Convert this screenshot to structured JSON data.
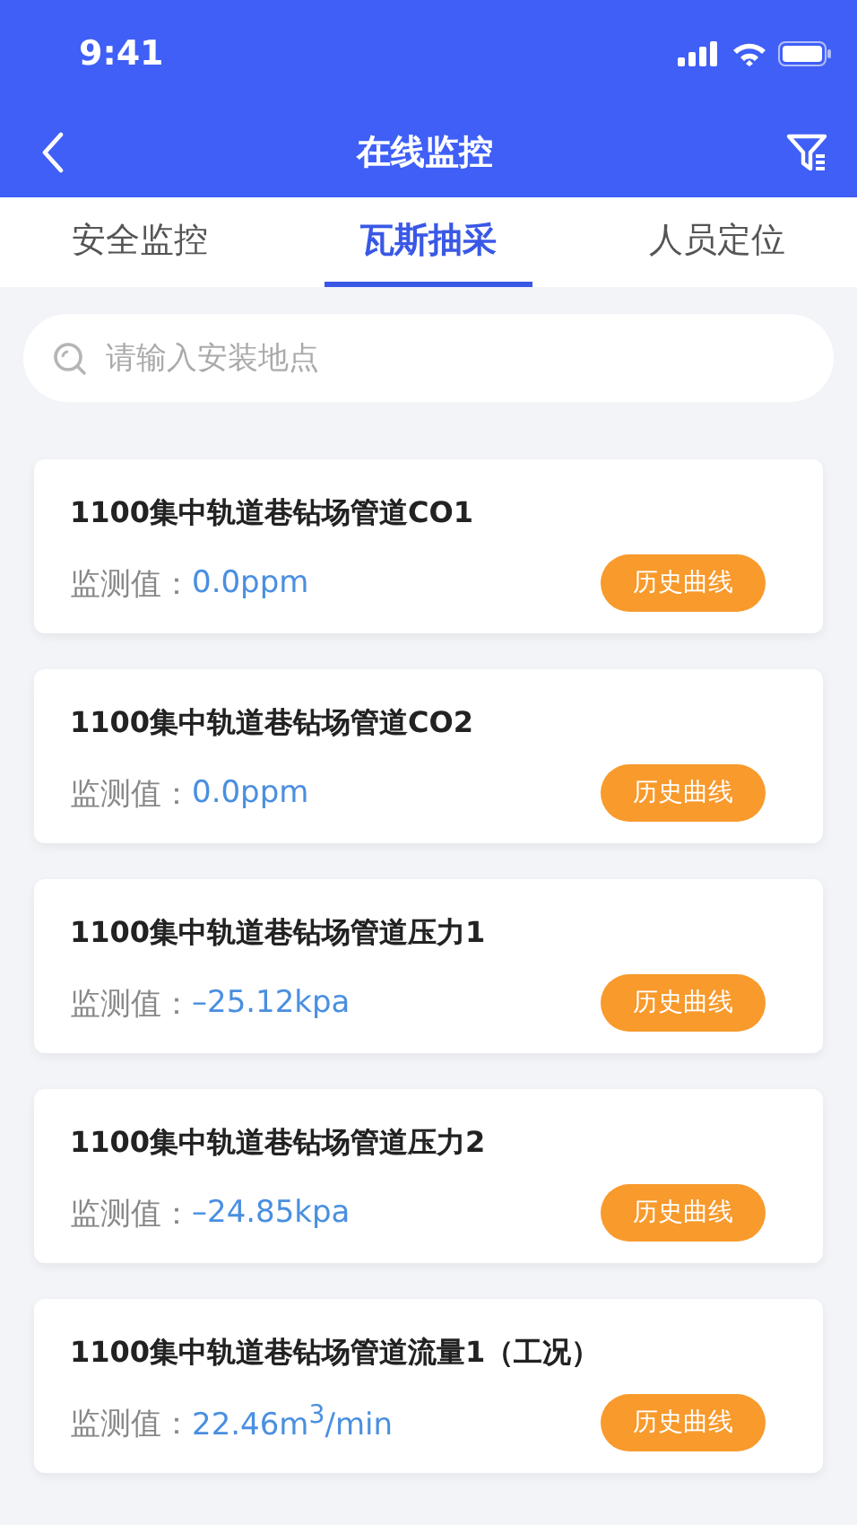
{
  "status_bar": {
    "time": "9:41"
  },
  "nav": {
    "title": "在线监控"
  },
  "tabs": [
    {
      "label": "安全监控",
      "selected": false
    },
    {
      "label": "瓦斯抽采",
      "selected": true
    },
    {
      "label": "人员定位",
      "selected": false
    }
  ],
  "search": {
    "placeholder": "请输入安装地点"
  },
  "cards": [
    {
      "title": "1100集中轨道巷钻场管道CO1",
      "label": "监测值：",
      "value": "0.0ppm",
      "button": "历史曲线"
    },
    {
      "title": "1100集中轨道巷钻场管道CO2",
      "label": "监测值：",
      "value": "0.0ppm",
      "button": "历史曲线"
    },
    {
      "title": "1100集中轨道巷钻场管道压力1",
      "label": "监测值：",
      "value": "–25.12kpa",
      "button": "历史曲线"
    },
    {
      "title": "1100集中轨道巷钻场管道压力2",
      "label": "监测值：",
      "value": "–24.85kpa",
      "button": "历史曲线"
    },
    {
      "title": "1100集中轨道巷钻场管道流量1（工况）",
      "label": "监测值：",
      "value": "22.46m$^{3}$/min",
      "button": "历史曲线"
    }
  ]
}
